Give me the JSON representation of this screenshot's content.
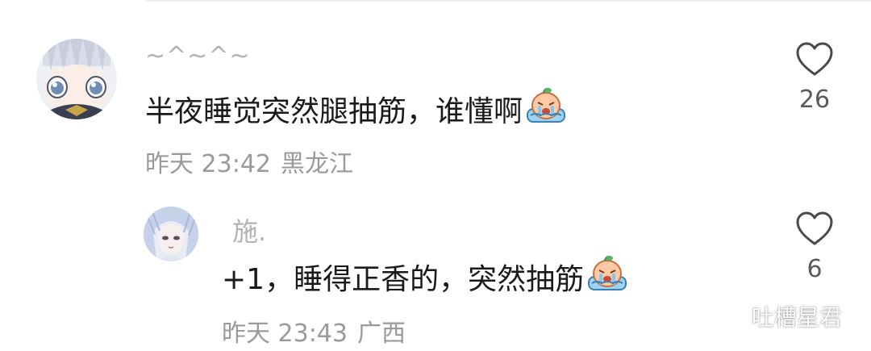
{
  "comments": [
    {
      "username": "~^~^~",
      "text": "半夜睡觉突然腿抽筋，谁懂啊",
      "emoji": "crying-face-emoji",
      "time": "昨天 23:42",
      "location": "黑龙江",
      "likes": "26"
    },
    {
      "username": "施.",
      "text": "+1，睡得正香的，突然抽筋",
      "emoji": "crying-face-emoji",
      "time": "昨天 23:43",
      "location": "广西",
      "likes": "6"
    }
  ],
  "watermark": {
    "icon": "wechat-icon",
    "text": "吐槽星君"
  },
  "colors": {
    "username": "#b3b3b3",
    "text": "#1a1a1a",
    "meta": "#9a9a9a",
    "heart": "#4a4a4a"
  }
}
